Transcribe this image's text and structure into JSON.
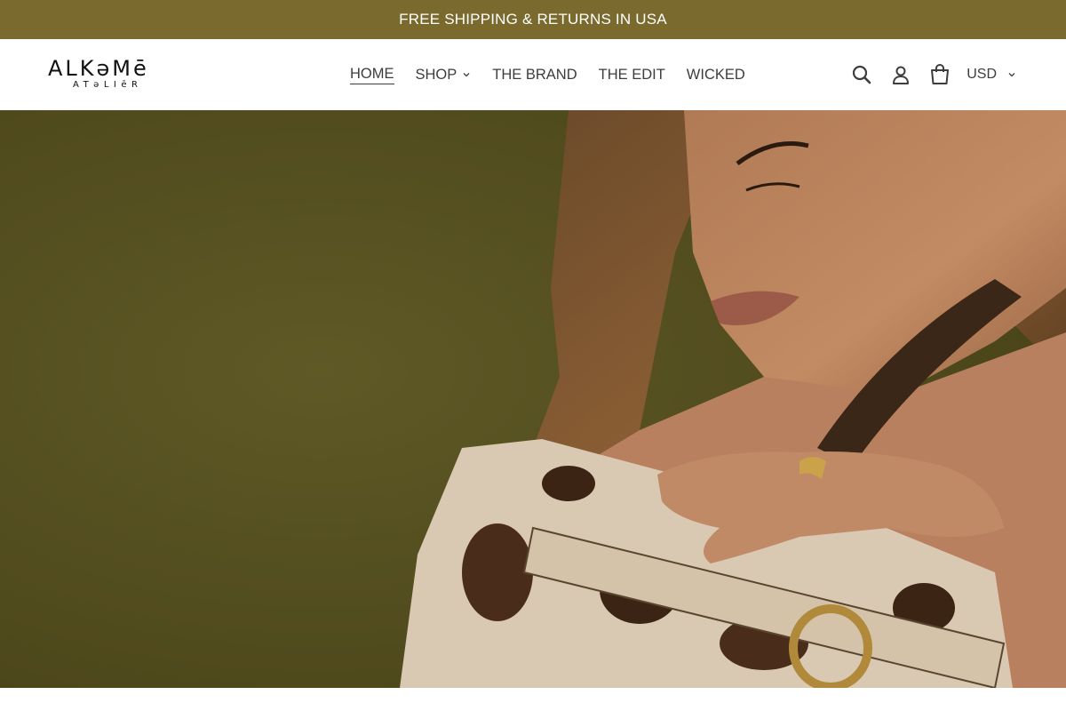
{
  "colors": {
    "announcement_bg": "#7a6a2e",
    "hero_bg": "#5a5423",
    "text": "#3d3d3d"
  },
  "announcement": {
    "text": "FREE SHIPPING & RETURNS IN USA"
  },
  "logo": {
    "main": "ALKəMē",
    "sub": "ATəLIēR"
  },
  "nav": {
    "items": [
      {
        "label": "HOME",
        "active": true
      },
      {
        "label": "SHOP",
        "has_dropdown": true
      },
      {
        "label": "THE BRAND"
      },
      {
        "label": "THE EDIT"
      },
      {
        "label": "WICKED"
      }
    ]
  },
  "actions": {
    "search_icon": "search-icon",
    "account_icon": "account-icon",
    "cart_icon": "cart-icon",
    "currency": "USD"
  },
  "hero": {
    "image": "woman-with-cow-print-bag"
  }
}
